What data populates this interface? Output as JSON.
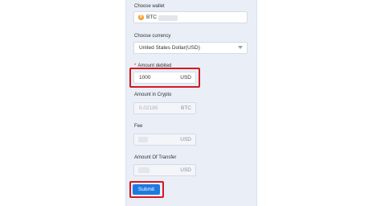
{
  "form": {
    "wallet": {
      "label": "Choose wallet",
      "value": "BTC",
      "coin_icon": "bitcoin-icon",
      "coin_symbol": "₿"
    },
    "currency": {
      "label": "Choose currency",
      "value": "United States Dollar(USD)",
      "icon": "chevron-down-icon"
    },
    "amount_debited": {
      "required_mark": "*",
      "label": "Amount debited",
      "value": "1000",
      "unit": "USD"
    },
    "amount_crypto": {
      "label": "Amount in Crypto",
      "value": "0.02185",
      "unit": "BTC"
    },
    "fee": {
      "label": "Fee",
      "unit": "USD"
    },
    "amount_transfer": {
      "label": "Amount Of Transfer",
      "unit": "USD"
    },
    "submit_label": "Submit"
  },
  "colors": {
    "accent": "#1e7ae0",
    "highlight": "#d71920",
    "panel": "#e9eef7",
    "coin": "#f7931a"
  }
}
